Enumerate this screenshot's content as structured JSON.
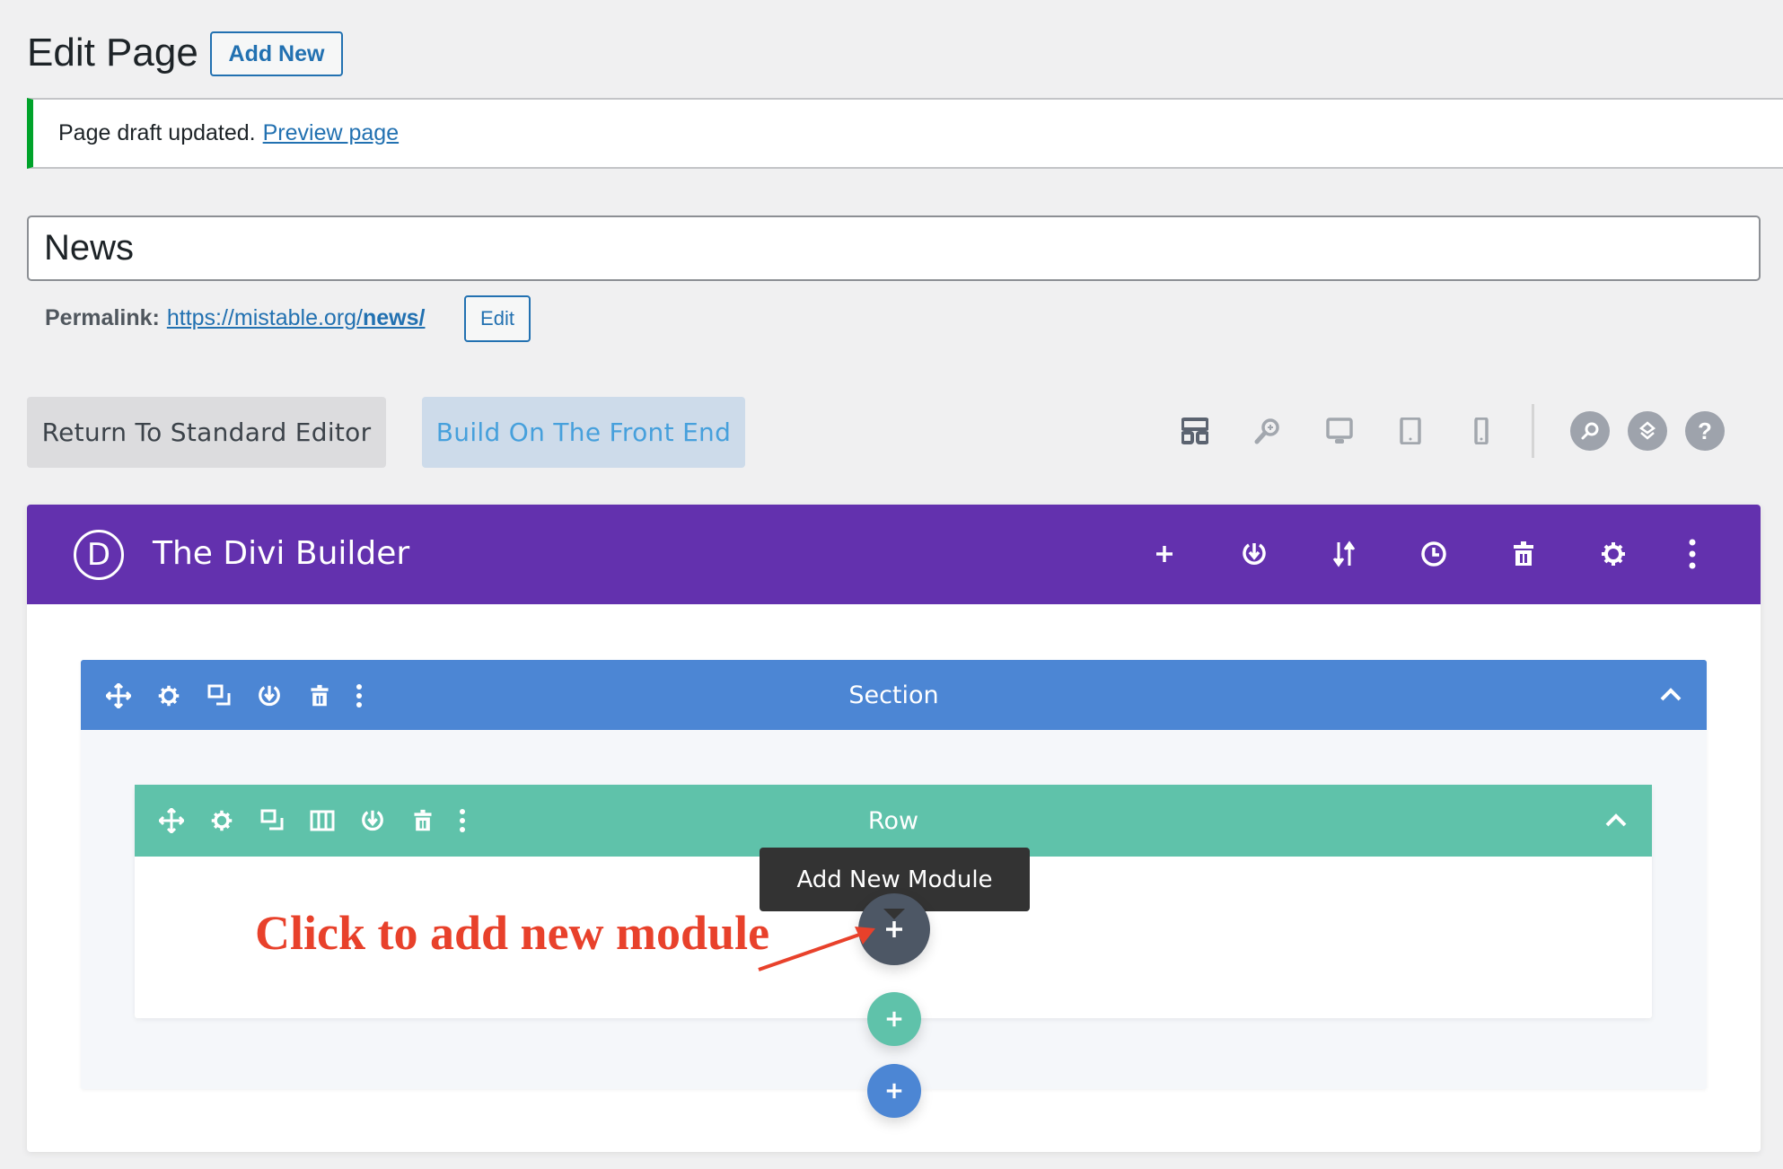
{
  "header": {
    "title": "Edit Page",
    "add_new_label": "Add New"
  },
  "notice": {
    "text": "Page draft updated.",
    "link": "Preview page",
    "accent": "#00a32a"
  },
  "post_title": {
    "value": "News"
  },
  "permalink": {
    "label": "Permalink:",
    "url_base": "https://mistable.org/",
    "slug": "news/",
    "edit_label": "Edit"
  },
  "editor_buttons": {
    "return_label": "Return To Standard Editor",
    "build_label": "Build On The Front End"
  },
  "toolbar_icons": [
    "layout-icon",
    "zoom-icon",
    "desktop-icon",
    "tablet-icon",
    "phone-icon",
    "search-icon",
    "layers-icon",
    "help-icon"
  ],
  "builder": {
    "logo_letter": "D",
    "title": "The Divi Builder",
    "color": "#6331ae",
    "header_icons": [
      "plus-icon",
      "load-icon",
      "sort-icon",
      "history-icon",
      "trash-icon",
      "gear-icon",
      "more-icon"
    ],
    "section": {
      "label": "Section",
      "color": "#4c86d4"
    },
    "row": {
      "label": "Row",
      "color": "#5fc2aa"
    },
    "tooltip": "Add New Module"
  },
  "annotation": {
    "text": "Click to add new module",
    "color": "#e8412b"
  }
}
